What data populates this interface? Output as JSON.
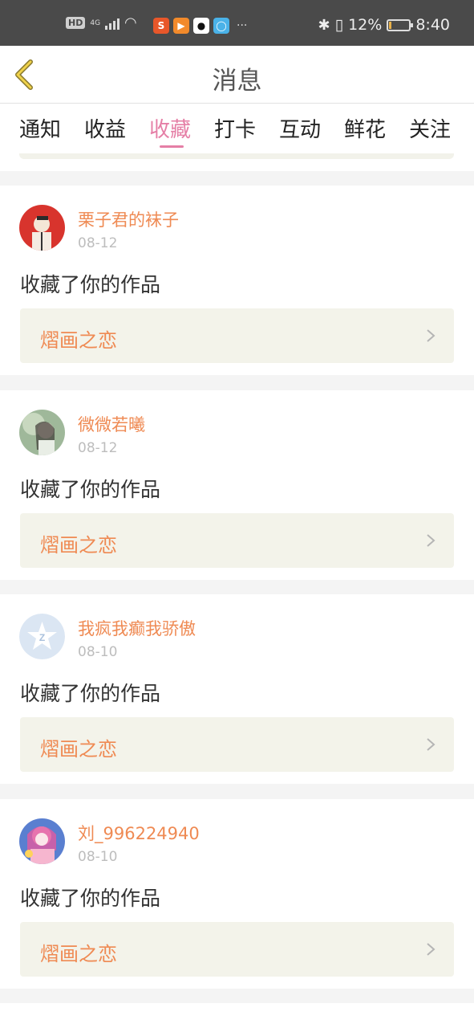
{
  "statusbar": {
    "hd": "HD",
    "network": "4G",
    "bluetooth": "✱",
    "battery_percent": "12%",
    "battery_level": 0.12,
    "time": "8:40",
    "more": "···"
  },
  "header": {
    "title": "消息"
  },
  "tabs": [
    {
      "label": "通知"
    },
    {
      "label": "收益"
    },
    {
      "label": "收藏",
      "active": true
    },
    {
      "label": "打卡"
    },
    {
      "label": "互动"
    },
    {
      "label": "鲜花"
    },
    {
      "label": "关注"
    }
  ],
  "items": [
    {
      "user": "栗子君的袜子",
      "date": "08-12",
      "action": "收藏了你的作品",
      "work": "熠画之恋"
    },
    {
      "user": "微微若曦",
      "date": "08-12",
      "action": "收藏了你的作品",
      "work": "熠画之恋"
    },
    {
      "user": "我疯我癫我骄傲",
      "date": "08-10",
      "action": "收藏了你的作品",
      "work": "熠画之恋"
    },
    {
      "user": "刘_996224940",
      "date": "08-10",
      "action": "收藏了你的作品",
      "work": "熠画之恋"
    }
  ],
  "colors": {
    "accent_pink": "#e57fa6",
    "username_orange": "#ef8a53",
    "card_bg": "#f3f3ea"
  }
}
